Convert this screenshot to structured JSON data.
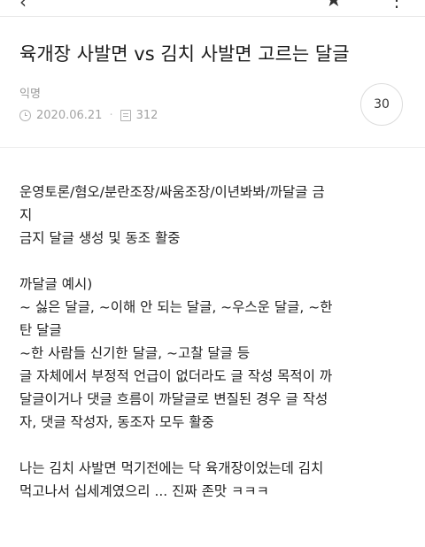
{
  "header": {
    "back_icon": "back-arrow-icon",
    "star_icon": "star-icon",
    "more_icon": "more-icon"
  },
  "post": {
    "title": "육개장 사발면 vs 김치 사발면 고르는 달글",
    "author": "익명",
    "date": "2020.06.21",
    "views": "312",
    "comment_count": "30"
  },
  "content": {
    "lines": [
      "운영토론/혐오/분란조장/싸움조장/이년봐봐/까달글 금",
      "지",
      "금지 달글 생성 및 동조 활중",
      "",
      "까달글 예시)",
      "~ 싫은 달글, ~이해 안 되는 달글, ~우스운 달글, ~한",
      "탄 달글",
      "~한 사람들 신기한 달글, ~고찰 달글 등",
      "글 자체에서 부정적 언급이 없더라도 글 작성 목적이 까",
      "달글이거나 댓글 흐름이 까달글로 변질된 경우 글 작성",
      "자, 댓글 작성자, 동조자 모두 활중",
      "",
      "나는 김치 사발면 먹기전에는 닥 육개장이었는데 김치",
      "먹고나서 십세계였으리 ... 진짜 존맛 ㅋㅋㅋ"
    ]
  }
}
